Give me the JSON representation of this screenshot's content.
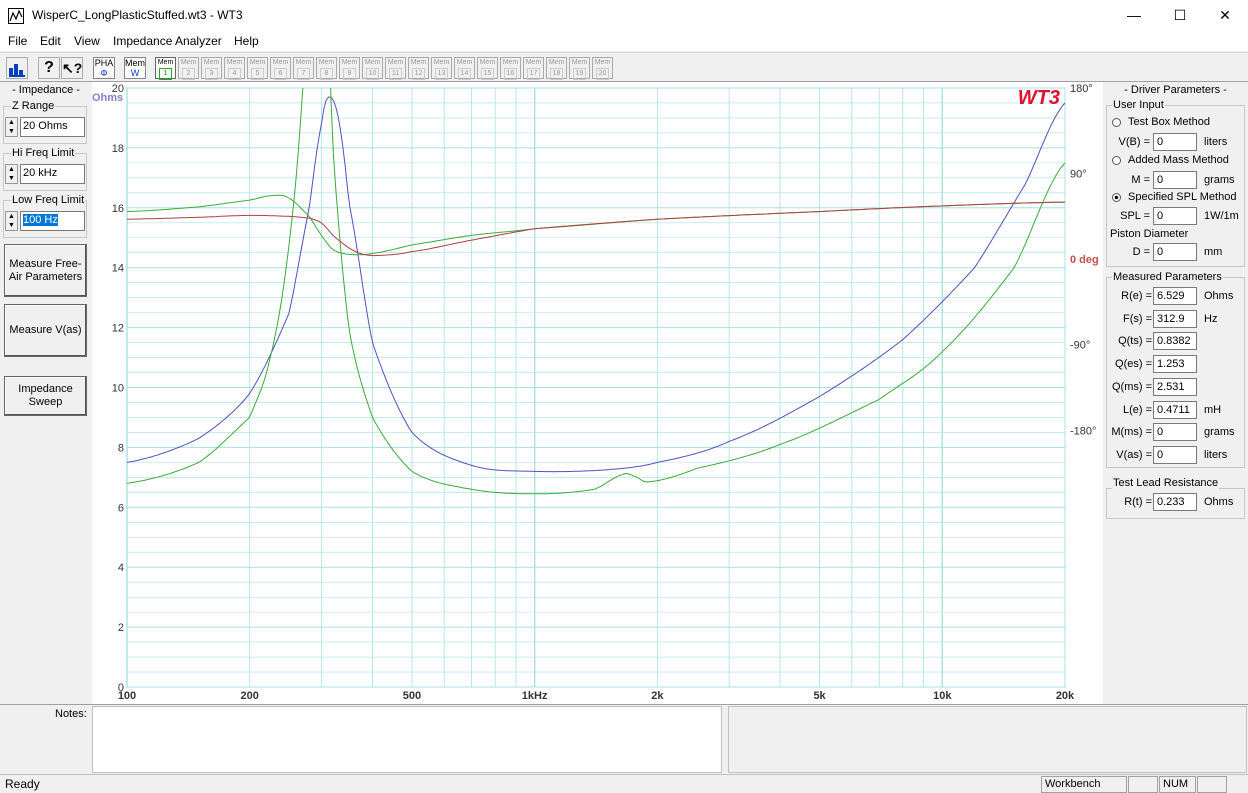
{
  "window": {
    "title": "WisperC_LongPlasticStuffed.wt3 - WT3",
    "minimize": "—",
    "maximize": "☐",
    "close": "✕"
  },
  "menu": [
    "File",
    "Edit",
    "View",
    "Impedance Analyzer",
    "Help"
  ],
  "toolbar": {
    "pha_label": "PHA",
    "pha_sub": "Φ",
    "memw_label": "Mem",
    "memw_sub": "W",
    "mem_label": "Mem",
    "mems": [
      "1",
      "2",
      "3",
      "4",
      "5",
      "6",
      "7",
      "8",
      "9",
      "10",
      "11",
      "12",
      "13",
      "14",
      "15",
      "16",
      "17",
      "18",
      "19",
      "20"
    ]
  },
  "impedance_panel": {
    "title": "- Impedance -",
    "z_range_label": "Z Range",
    "z_range_value": "20 Ohms",
    "hi_freq_label": "Hi Freq Limit",
    "hi_freq_value": "20 kHz",
    "low_freq_label": "Low Freq Limit",
    "low_freq_value": "100 Hz",
    "btn_measure_free_air": "Measure Free-Air Parameters",
    "btn_measure_vas": "Measure V(as)",
    "btn_impedance_sweep": "Impedance Sweep"
  },
  "driver_panel": {
    "title": "- Driver Parameters -",
    "user_input_title": "User Input",
    "test_box_method": "Test Box Method",
    "vb_label": "V(B) =",
    "vb_value": "0",
    "vb_unit": "liters",
    "added_mass_method": "Added Mass Method",
    "m_label": "M =",
    "m_value": "0",
    "m_unit": "grams",
    "spl_method": "Specified SPL Method",
    "spl_label": "SPL =",
    "spl_value": "0",
    "spl_unit": "1W/1m",
    "piston_label": "Piston Diameter",
    "d_label": "D =",
    "d_value": "0",
    "d_unit": "mm",
    "measured_title": "Measured Parameters",
    "measured": [
      {
        "label": "R(e) =",
        "value": "6.529",
        "unit": "Ohms"
      },
      {
        "label": "F(s) =",
        "value": "312.9",
        "unit": "Hz"
      },
      {
        "label": "Q(ts) =",
        "value": "0.8382",
        "unit": ""
      },
      {
        "label": "Q(es) =",
        "value": "1.253",
        "unit": ""
      },
      {
        "label": "Q(ms) =",
        "value": "2.531",
        "unit": ""
      },
      {
        "label": "L(e) =",
        "value": "0.4711",
        "unit": "mH"
      },
      {
        "label": "M(ms) =",
        "value": "0",
        "unit": "grams"
      },
      {
        "label": "V(as) =",
        "value": "0",
        "unit": "liters"
      }
    ],
    "lead_title": "Test Lead Resistance",
    "rt_label": "R(t) =",
    "rt_value": "0.233",
    "rt_unit": "Ohms"
  },
  "notes_label": "Notes:",
  "status": {
    "ready": "Ready",
    "workbench": "Workbench",
    "num": "NUM"
  },
  "chart_data": {
    "type": "line",
    "brand": "WT3",
    "ylabel": "Ohms",
    "ylim": [
      0,
      20
    ],
    "y_ticks": [
      "0",
      "2",
      "4",
      "6",
      "8",
      "10",
      "12",
      "14",
      "16",
      "18",
      "20"
    ],
    "x_scale": "log",
    "xlim": [
      100,
      20000
    ],
    "x_ticks": [
      {
        "v": 100,
        "l": "100"
      },
      {
        "v": 200,
        "l": "200"
      },
      {
        "v": 500,
        "l": "500"
      },
      {
        "v": 1000,
        "l": "1kHz"
      },
      {
        "v": 2000,
        "l": "2k"
      },
      {
        "v": 5000,
        "l": "5k"
      },
      {
        "v": 10000,
        "l": "10k"
      },
      {
        "v": 20000,
        "l": "20k"
      }
    ],
    "phase_ticks": [
      {
        "v": 180,
        "l": "180°"
      },
      {
        "v": 90,
        "l": "90°"
      },
      {
        "v": 0,
        "l": "0 deg"
      },
      {
        "v": -90,
        "l": "-90°"
      },
      {
        "v": -180,
        "l": "-180°"
      }
    ],
    "phase_ylim": [
      -450,
      180
    ],
    "colors": {
      "blue": "#5050c0",
      "green": "#3aaa3a",
      "red": "#b04040",
      "grid": "#a8e0e0"
    },
    "series": [
      {
        "color": "blue",
        "axis": "ohms",
        "x": [
          100,
          150,
          200,
          250,
          280,
          300,
          312,
          330,
          350,
          400,
          500,
          700,
          1000,
          1500,
          2000,
          3000,
          5000,
          8000,
          12000,
          16000,
          20000
        ],
        "y": [
          7.5,
          8.3,
          9.8,
          12.5,
          16.0,
          18.8,
          19.7,
          19.0,
          16.2,
          11.5,
          8.5,
          7.4,
          7.2,
          7.25,
          7.5,
          8.2,
          9.7,
          11.6,
          14.0,
          16.8,
          19.5
        ]
      },
      {
        "color": "green",
        "axis": "ohms",
        "x": [
          100,
          150,
          200,
          220,
          240,
          260,
          280,
          300,
          320,
          350,
          400,
          500,
          700,
          1000,
          1400,
          1650,
          1750,
          1900,
          2500,
          4000,
          7000,
          10000,
          15000,
          20000
        ],
        "y": [
          6.8,
          7.5,
          9.0,
          10.5,
          13.0,
          17.0,
          23.0,
          28.0,
          18.0,
          12.0,
          9.0,
          7.2,
          6.6,
          6.45,
          6.6,
          7.1,
          7.05,
          6.85,
          7.3,
          8.1,
          9.6,
          11.2,
          14.0,
          17.5
        ]
      },
      {
        "color": "green",
        "axis": "phase",
        "x": [
          100,
          150,
          200,
          230,
          250,
          280,
          300,
          320,
          350,
          400,
          500,
          700,
          1000,
          2000,
          5000,
          10000,
          20000
        ],
        "y": [
          50,
          55,
          62,
          67,
          64,
          45,
          25,
          10,
          5,
          6,
          15,
          25,
          32,
          42,
          50,
          56,
          60
        ]
      },
      {
        "color": "red",
        "axis": "phase",
        "x": [
          100,
          150,
          200,
          250,
          280,
          300,
          320,
          350,
          380,
          420,
          500,
          700,
          1000,
          2000,
          5000,
          10000,
          20000
        ],
        "y": [
          42,
          44,
          46,
          45,
          43,
          38,
          25,
          12,
          5,
          4,
          8,
          20,
          32,
          42,
          50,
          56,
          60
        ]
      }
    ]
  }
}
